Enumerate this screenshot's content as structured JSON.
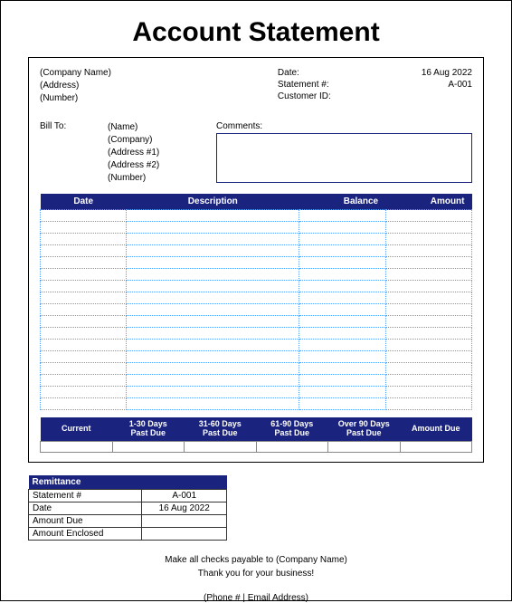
{
  "title": "Account Statement",
  "company": {
    "name": "(Company Name)",
    "address": "(Address)",
    "number": "(Number)"
  },
  "meta": {
    "date_label": "Date:",
    "date": "16 Aug 2022",
    "statement_label": "Statement #:",
    "statement_no": "A-001",
    "customer_label": "Customer ID:",
    "customer_id": ""
  },
  "billto": {
    "label": "Bill To:",
    "name": "(Name)",
    "company": "(Company)",
    "address1": "(Address #1)",
    "address2": "(Address #2)",
    "number": "(Number)"
  },
  "comments_label": "Comments:",
  "table": {
    "headers": {
      "date": "Date",
      "desc": "Description",
      "balance": "Balance",
      "amount": "Amount"
    },
    "rows": [
      {
        "date": "",
        "desc": "",
        "balance": "",
        "amount": ""
      },
      {
        "date": "",
        "desc": "",
        "balance": "",
        "amount": ""
      },
      {
        "date": "",
        "desc": "",
        "balance": "",
        "amount": ""
      },
      {
        "date": "",
        "desc": "",
        "balance": "",
        "amount": ""
      },
      {
        "date": "",
        "desc": "",
        "balance": "",
        "amount": ""
      },
      {
        "date": "",
        "desc": "",
        "balance": "",
        "amount": ""
      },
      {
        "date": "",
        "desc": "",
        "balance": "",
        "amount": ""
      },
      {
        "date": "",
        "desc": "",
        "balance": "",
        "amount": ""
      },
      {
        "date": "",
        "desc": "",
        "balance": "",
        "amount": ""
      },
      {
        "date": "",
        "desc": "",
        "balance": "",
        "amount": ""
      },
      {
        "date": "",
        "desc": "",
        "balance": "",
        "amount": ""
      },
      {
        "date": "",
        "desc": "",
        "balance": "",
        "amount": ""
      },
      {
        "date": "",
        "desc": "",
        "balance": "",
        "amount": ""
      },
      {
        "date": "",
        "desc": "",
        "balance": "",
        "amount": ""
      },
      {
        "date": "",
        "desc": "",
        "balance": "",
        "amount": ""
      },
      {
        "date": "",
        "desc": "",
        "balance": "",
        "amount": ""
      },
      {
        "date": "",
        "desc": "",
        "balance": "",
        "amount": ""
      }
    ]
  },
  "aging": {
    "headers": [
      "Current",
      "1-30 Days\nPast Due",
      "31-60 Days\nPast Due",
      "61-90 Days\nPast Due",
      "Over 90 Days\nPast Due",
      "Amount Due"
    ],
    "values": [
      "",
      "",
      "",
      "",
      "",
      ""
    ]
  },
  "remittance": {
    "title": "Remittance",
    "rows": [
      {
        "label": "Statement #",
        "value": "A-001"
      },
      {
        "label": "Date",
        "value": "16 Aug 2022"
      },
      {
        "label": "Amount Due",
        "value": ""
      },
      {
        "label": "Amount Enclosed",
        "value": ""
      }
    ]
  },
  "footer": {
    "line1": "Make all checks payable to (Company Name)",
    "line2": "Thank you for your business!",
    "contact": "(Phone # | Email Address)"
  }
}
